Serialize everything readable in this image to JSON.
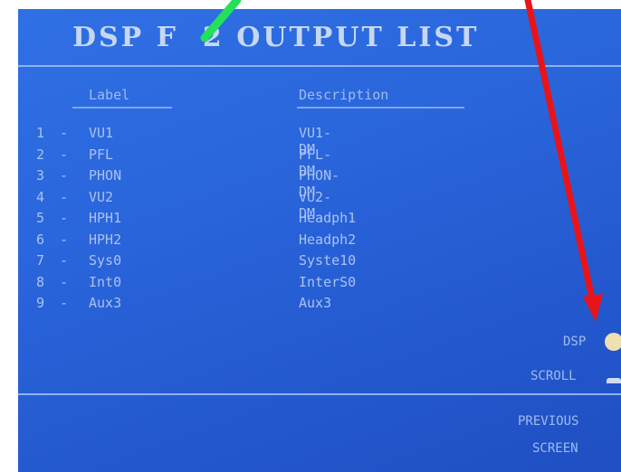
{
  "screen": {
    "title": "DSP F  2 OUTPUT LIST"
  },
  "columns": {
    "label_header": "Label",
    "description_header": "Description"
  },
  "rows": [
    {
      "num": "1",
      "label": "VU1",
      "description": "VU1-DM"
    },
    {
      "num": "2",
      "label": "PFL",
      "description": "PFL-DM"
    },
    {
      "num": "3",
      "label": "PHON",
      "description": "PHON-DM"
    },
    {
      "num": "4",
      "label": "VU2",
      "description": "VU2-DM"
    },
    {
      "num": "5",
      "label": "HPH1",
      "description": "Headph1"
    },
    {
      "num": "6",
      "label": "HPH2",
      "description": "Headph2"
    },
    {
      "num": "7",
      "label": "Sys0",
      "description": "Syste10"
    },
    {
      "num": "8",
      "label": "Int0",
      "description": "InterS0"
    },
    {
      "num": "9",
      "label": "Aux3",
      "description": "Aux3"
    }
  ],
  "separator": "-",
  "side_buttons": {
    "dsp": "DSP",
    "scroll": "SCROLL",
    "previous": "PREVIOUS",
    "screen": "SCREEN"
  },
  "colors": {
    "screen_background": "#2a66dc",
    "text": "#a9c2f2",
    "title": "#c7d7f3",
    "red_arrow": "#e8141a",
    "green_arrow": "#22e05a"
  },
  "icons": {
    "dsp_knob": "knob-icon",
    "scroll_marker": "scroll-icon",
    "red_arrow": "red-arrow-annotation",
    "green_arrow": "green-arrow-annotation"
  }
}
